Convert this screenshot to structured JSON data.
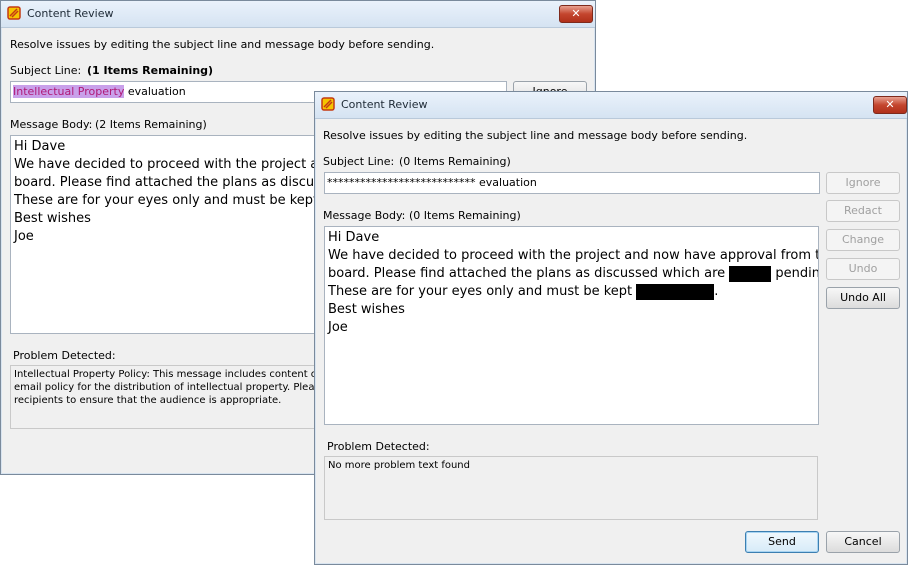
{
  "back": {
    "title": "Content Review",
    "close": "✕",
    "instruction": "Resolve issues by editing the subject line and message body before sending.",
    "subject_label": "Subject Line:",
    "subject_remaining": "(1 Items Remaining)",
    "subject_highlight": "Intellectual Property",
    "subject_rest": " evaluation",
    "ignore_label": "Ignore",
    "body_label": "Message Body:",
    "body_remaining": "(2 Items Remaining)",
    "body_lines": [
      "Hi Dave",
      "We have decided to proceed with the project and",
      "board. Please find attached the plans as discussed",
      "These are for your eyes only and must be kept co",
      "Best wishes",
      "Joe"
    ],
    "problem_label": "Problem Detected:",
    "problem_lines": [
      "Intellectual Property Policy:  This message includes content or at",
      "email policy for the distribution of intellectual property.  Please rev",
      "recipients to ensure that the audience is appropriate."
    ]
  },
  "front": {
    "title": "Content Review",
    "close": "✕",
    "instruction": "Resolve issues by editing the subject line and message body before sending.",
    "subject_label": "Subject Line:",
    "subject_remaining": "(0 Items Remaining)",
    "subject_value": "*************************** evaluation",
    "body_label": "Message Body:",
    "body_remaining": "(0 Items Remaining)",
    "body_line1": "Hi Dave",
    "body_line2": "We have decided to proceed with the project and now have approval from the",
    "body_line3_a": "board. Please find attached the plans as discussed which are ",
    "body_line3_b": " pending..",
    "body_line4_a": "These are for your eyes only and must be kept ",
    "body_line4_b": ".",
    "body_line5": "Best wishes",
    "body_line6": "Joe",
    "buttons": {
      "ignore": "Ignore",
      "redact": "Redact",
      "change": "Change",
      "undo": "Undo",
      "undo_all": "Undo All"
    },
    "problem_label": "Problem Detected:",
    "problem_text": "No more problem text found",
    "send_label": "Send",
    "cancel_label": "Cancel"
  },
  "colors": {
    "highlight_text": "#b01a78",
    "highlight_bg": "#c9a0ea",
    "redaction": "#000000"
  },
  "icons": {
    "app": "content-review-icon",
    "close": "close-icon"
  }
}
